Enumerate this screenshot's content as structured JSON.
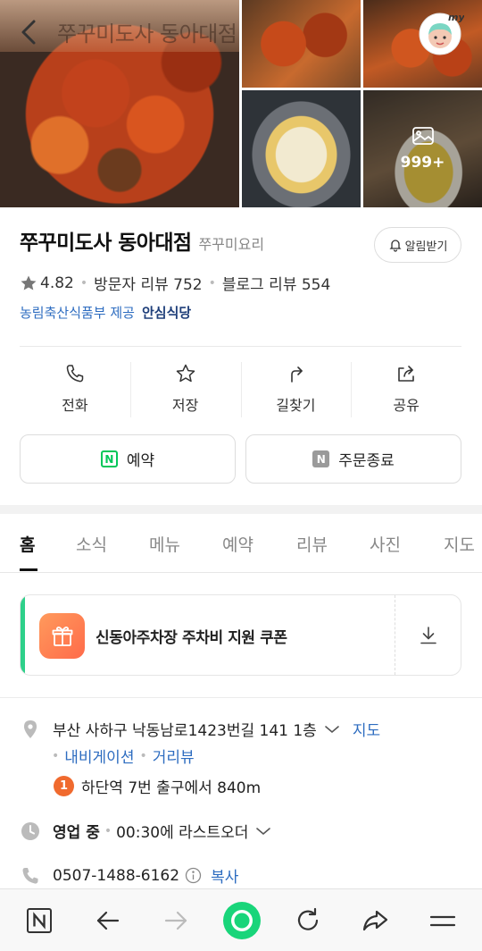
{
  "header": {
    "title": "쭈꾸미도사 동아대점",
    "more_photos_count": "999+"
  },
  "place": {
    "name": "쭈꾸미도사 동아대점",
    "category": "쭈꾸미요리",
    "alert_label": "알림받기",
    "rating": "4.82",
    "visitor_reviews": "방문자 리뷰 752",
    "blog_reviews": "블로그 리뷰 554",
    "provider": "농림축산식품부 제공",
    "safe_label": "안심식당"
  },
  "actions": [
    {
      "label": "전화",
      "icon": "phone-icon"
    },
    {
      "label": "저장",
      "icon": "star-icon"
    },
    {
      "label": "길찾기",
      "icon": "directions-icon"
    },
    {
      "label": "공유",
      "icon": "share-icon"
    }
  ],
  "booking": {
    "reserve_label": "예약",
    "order_label": "주문종료",
    "badge_letter": "N"
  },
  "tabs": [
    "홈",
    "소식",
    "메뉴",
    "예약",
    "리뷰",
    "사진",
    "지도"
  ],
  "coupon": {
    "text": "신동아주차장 주차비 지원 쿠폰"
  },
  "details": {
    "address": "부산 사하구 낙동남로1423번길 141 1층",
    "map_link": "지도",
    "navigation_link": "내비게이션",
    "roadview_link": "거리뷰",
    "subway_line": "1",
    "subway_text": "하단역 7번 출구에서 840m",
    "hours_status": "영업 중",
    "hours_detail": "00:30에 라스트오더",
    "phone": "0507-1488-6162",
    "copy_label": "복사"
  },
  "colors": {
    "link": "#2d6cc0",
    "naver_green": "#03c75a",
    "coupon_accent": "#2ed08a",
    "subway_orange": "#f06a2e"
  }
}
